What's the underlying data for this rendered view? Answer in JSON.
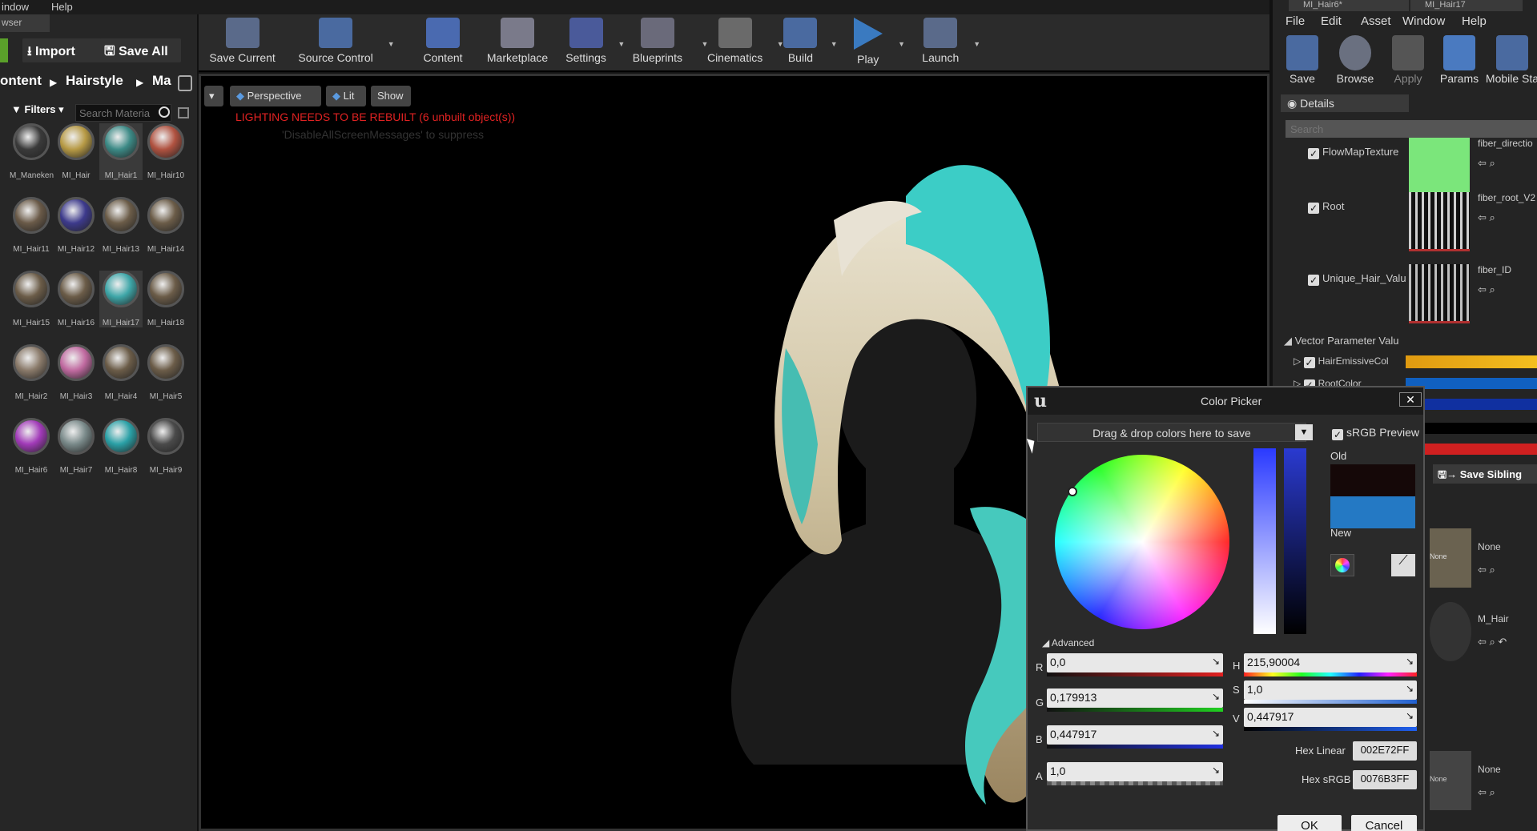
{
  "menubar": {
    "window": "indow",
    "help": "Help"
  },
  "browser": {
    "tab": "wser",
    "import_label": "Import",
    "save_all_label": "Save All",
    "breadcrumb": [
      "ontent",
      "Hairstyle",
      "Ma"
    ],
    "filters_label": "Filters",
    "search_placeholder": "Search Materia",
    "assets": [
      {
        "name": "M_Maneken",
        "color": "#3a3a3a"
      },
      {
        "name": "MI_Hair",
        "color": "#b79a45"
      },
      {
        "name": "MI_Hair1",
        "color": "#3c8a86"
      },
      {
        "name": "MI_Hair10",
        "color": "#b05240"
      },
      {
        "name": "MI_Hair11",
        "color": "#6a5a48"
      },
      {
        "name": "MI_Hair12",
        "color": "#3d3a8c"
      },
      {
        "name": "MI_Hair13",
        "color": "#6b5c48"
      },
      {
        "name": "MI_Hair14",
        "color": "#6b5c48"
      },
      {
        "name": "MI_Hair15",
        "color": "#6b5c48"
      },
      {
        "name": "MI_Hair16",
        "color": "#6b5c48"
      },
      {
        "name": "MI_Hair17",
        "color": "#3ea6a8"
      },
      {
        "name": "MI_Hair18",
        "color": "#6b5c48"
      },
      {
        "name": "MI_Hair2",
        "color": "#8a7a6a"
      },
      {
        "name": "MI_Hair3",
        "color": "#c06aa0"
      },
      {
        "name": "MI_Hair4",
        "color": "#6b5c48"
      },
      {
        "name": "MI_Hair5",
        "color": "#6b5c48"
      },
      {
        "name": "MI_Hair6",
        "color": "#a13ab8"
      },
      {
        "name": "MI_Hair7",
        "color": "#7a8a8a"
      },
      {
        "name": "MI_Hair8",
        "color": "#2aa0a6"
      },
      {
        "name": "MI_Hair9",
        "color": "#4a4a4a"
      }
    ]
  },
  "toolbar": [
    {
      "label": "Save Current",
      "icon": "save-icon",
      "color": "#5a6a8a"
    },
    {
      "label": "Source Control",
      "icon": "source-control-icon",
      "color": "#4a6aa0"
    },
    {
      "label": "Content",
      "icon": "content-icon",
      "color": "#4a6ab0"
    },
    {
      "label": "Marketplace",
      "icon": "marketplace-icon",
      "color": "#7a7a8a"
    },
    {
      "label": "Settings",
      "icon": "gear-icon",
      "color": "#4a5a9a"
    },
    {
      "label": "Blueprints",
      "icon": "blueprints-icon",
      "color": "#6a6a7a"
    },
    {
      "label": "Cinematics",
      "icon": "clapper-icon",
      "color": "#6a6a6a"
    },
    {
      "label": "Build",
      "icon": "build-icon",
      "color": "#4a6aa0"
    },
    {
      "label": "Play",
      "icon": "play-icon",
      "color": "#3a7ac0"
    },
    {
      "label": "Launch",
      "icon": "launch-icon",
      "color": "#5a6a8a"
    }
  ],
  "viewport": {
    "perspective": "Perspective",
    "lit": "Lit",
    "show": "Show",
    "warning": "LIGHTING NEEDS TO BE REBUILT (6 unbuilt object(s))",
    "hint": "'DisableAllScreenMessages' to suppress"
  },
  "material_editor": {
    "tabs": [
      "MI_Hair6*",
      "MI_Hair17"
    ],
    "menu": [
      "File",
      "Edit",
      "Asset",
      "Window",
      "Help"
    ],
    "toolbar": [
      "Save",
      "Browse",
      "Apply",
      "Params",
      "Mobile Sta"
    ],
    "details_tab": "Details",
    "search_placeholder": "Search",
    "textures": [
      {
        "param": "FlowMapTexture",
        "asset": "fiber_directio",
        "color": "#7be67b"
      },
      {
        "param": "Root",
        "asset": "fiber_root_V2",
        "color": "#cfcfcf"
      },
      {
        "param": "Unique_Hair_Valu",
        "asset": "fiber_ID",
        "color": "#bdbdbd"
      }
    ],
    "vector_section": "Vector Parameter Valu",
    "vectors": [
      "HairEmissiveCol",
      "RootColor"
    ],
    "save_sibling": "Save Sibling",
    "none_label": "None",
    "m_hair": "M_Hair"
  },
  "color_picker": {
    "title": "Color Picker",
    "drop_hint": "Drag & drop colors here to save",
    "srgb_preview": "sRGB Preview",
    "old_label": "Old",
    "new_label": "New",
    "old_color": "#150808",
    "new_color": "#2479c4",
    "advanced_label": "Advanced",
    "r": {
      "label": "R",
      "value": "0,0"
    },
    "g": {
      "label": "G",
      "value": "0,179913"
    },
    "b": {
      "label": "B",
      "value": "0,447917"
    },
    "a": {
      "label": "A",
      "value": "1,0"
    },
    "h": {
      "label": "H",
      "value": "215,90004"
    },
    "s": {
      "label": "S",
      "value": "1,0"
    },
    "v": {
      "label": "V",
      "value": "0,447917"
    },
    "hex_linear_label": "Hex Linear",
    "hex_linear": "002E72FF",
    "hex_srgb_label": "Hex sRGB",
    "hex_srgb": "0076B3FF",
    "ok": "OK",
    "cancel": "Cancel"
  }
}
